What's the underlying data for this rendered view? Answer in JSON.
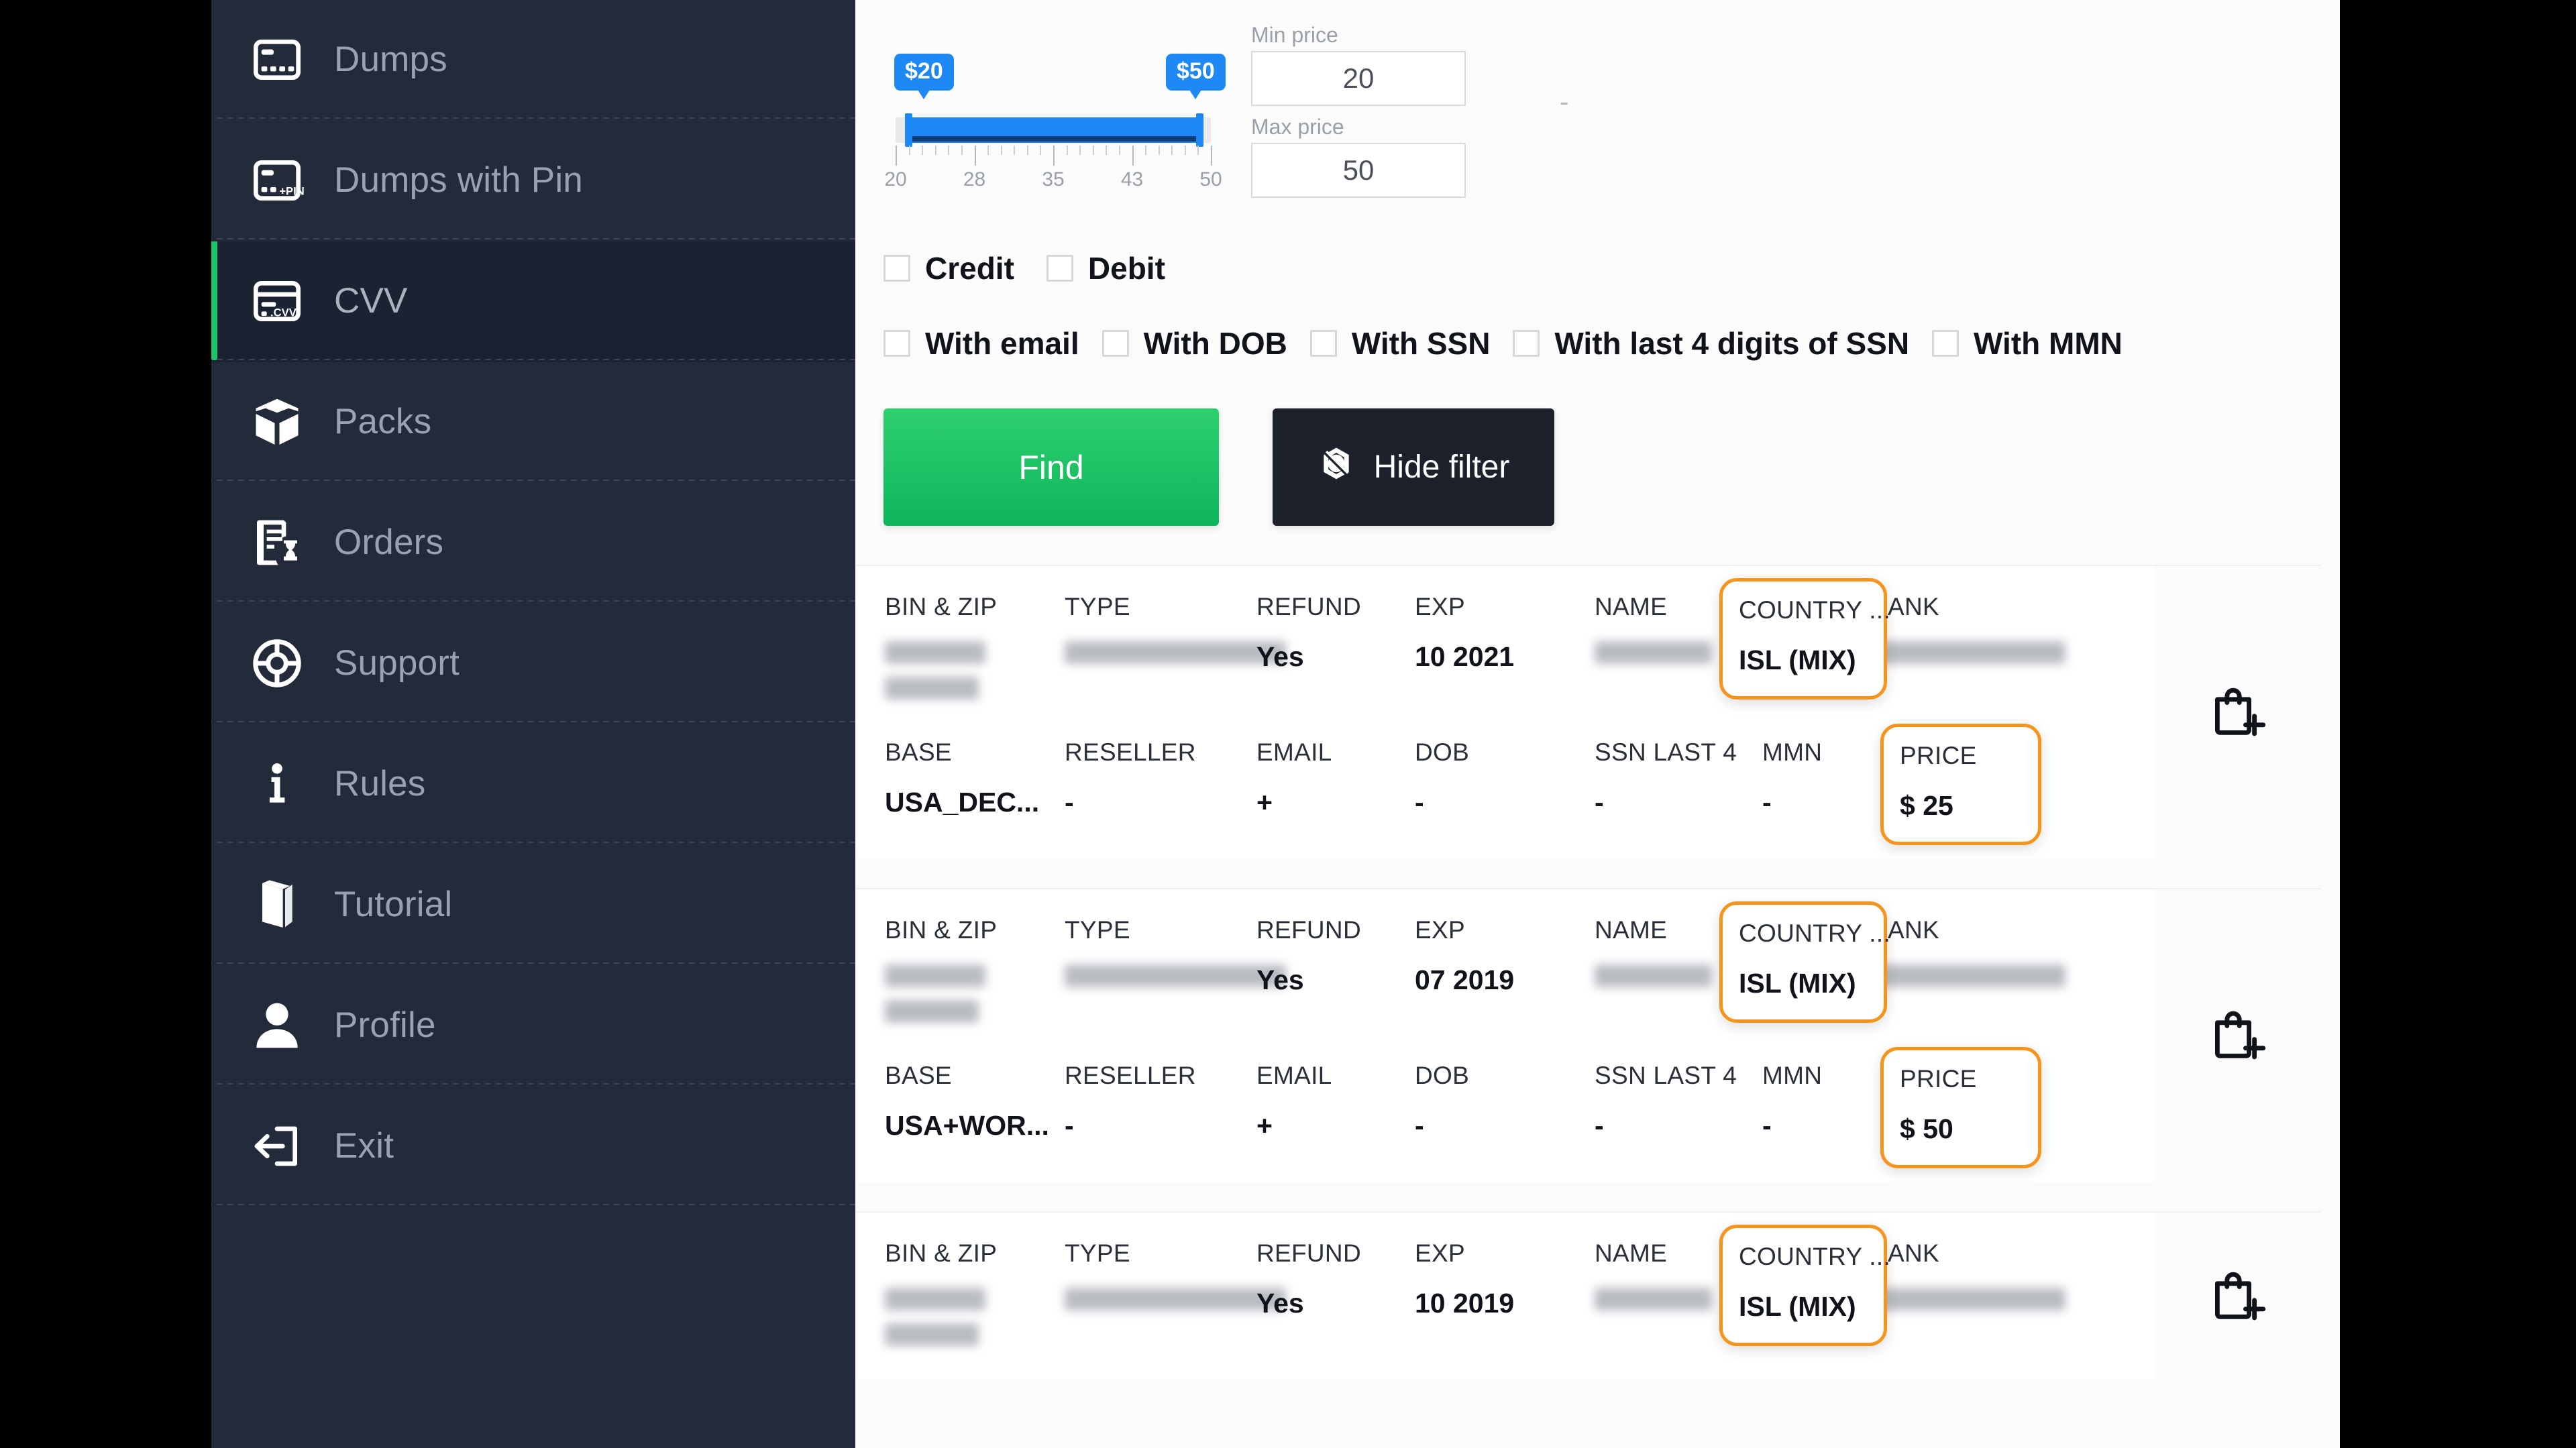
{
  "sidebar": {
    "items": [
      {
        "label": "Dumps",
        "icon": "card-dumps-icon",
        "active": false
      },
      {
        "label": "Dumps with Pin",
        "icon": "card-pin-icon",
        "active": false
      },
      {
        "label": "CVV",
        "icon": "card-cvv-icon",
        "active": true
      },
      {
        "label": "Packs",
        "icon": "box-icon",
        "active": false
      },
      {
        "label": "Orders",
        "icon": "orders-icon",
        "active": false
      },
      {
        "label": "Support",
        "icon": "lifebuoy-icon",
        "active": false
      },
      {
        "label": "Rules",
        "icon": "info-icon",
        "active": false
      },
      {
        "label": "Tutorial",
        "icon": "book-icon",
        "active": false
      },
      {
        "label": "Profile",
        "icon": "user-icon",
        "active": false
      },
      {
        "label": "Exit",
        "icon": "logout-icon",
        "active": false
      }
    ]
  },
  "filter": {
    "slider": {
      "min_bubble": "$20",
      "max_bubble": "$50",
      "tick_labels": [
        "20",
        "28",
        "35",
        "43",
        "50"
      ],
      "range_min": 20,
      "range_max": 50,
      "value_min": 20,
      "value_max": 50,
      "accent_color": "#1e88f5"
    },
    "min_price": {
      "label": "Min price",
      "value": "20"
    },
    "max_price": {
      "label": "Max price",
      "value": "50"
    },
    "separator": "-",
    "card_type_checkboxes": [
      {
        "label": "Credit",
        "checked": false
      },
      {
        "label": "Debit",
        "checked": false
      }
    ],
    "data_checkboxes": [
      {
        "label": "With email",
        "checked": false
      },
      {
        "label": "With DOB",
        "checked": false
      },
      {
        "label": "With SSN",
        "checked": false
      },
      {
        "label": "With last 4 digits of SSN",
        "checked": false
      },
      {
        "label": "With MMN",
        "checked": false
      }
    ],
    "find_button": {
      "label": "Find",
      "color": "#1ec46a"
    },
    "hide_button": {
      "label": "Hide filter",
      "icon": "eye-slash-icon",
      "color": "#1c212b"
    }
  },
  "results": {
    "headers_top": [
      "BIN & ZIP",
      "TYPE",
      "REFUND",
      "EXP",
      "NAME",
      "COUNTRY ...",
      "BANK"
    ],
    "headers_bottom": [
      "BASE",
      "RESELLER",
      "EMAIL",
      "DOB",
      "SSN LAST 4",
      "MMN",
      "PRICE"
    ],
    "highlight_color": "#f7941e",
    "cart_icon": "shopping-bag-plus-icon",
    "rows": [
      {
        "bin_zip": "",
        "type": "",
        "refund": "Yes",
        "exp": "10 2021",
        "name": "",
        "country": "ISL (MIX)",
        "bank": "",
        "base": "USA_DEC...",
        "reseller": "-",
        "email": "+",
        "dob": "-",
        "ssn_last4": "-",
        "mmn": "-",
        "price": "$ 25",
        "highlight_country": true,
        "highlight_price": true
      },
      {
        "bin_zip": "",
        "type": "",
        "refund": "Yes",
        "exp": "07 2019",
        "name": "",
        "country": "ISL (MIX)",
        "bank": "",
        "base": "USA+WOR...",
        "reseller": "-",
        "email": "+",
        "dob": "-",
        "ssn_last4": "-",
        "mmn": "-",
        "price": "$ 50",
        "highlight_country": true,
        "highlight_price": true
      },
      {
        "bin_zip": "",
        "type": "",
        "refund": "Yes",
        "exp": "10 2019",
        "name": "",
        "country": "ISL (MIX)",
        "bank": "",
        "base": "",
        "reseller": "",
        "email": "",
        "dob": "",
        "ssn_last4": "",
        "mmn": "",
        "price": "",
        "highlight_country": true,
        "highlight_price": false
      }
    ]
  }
}
